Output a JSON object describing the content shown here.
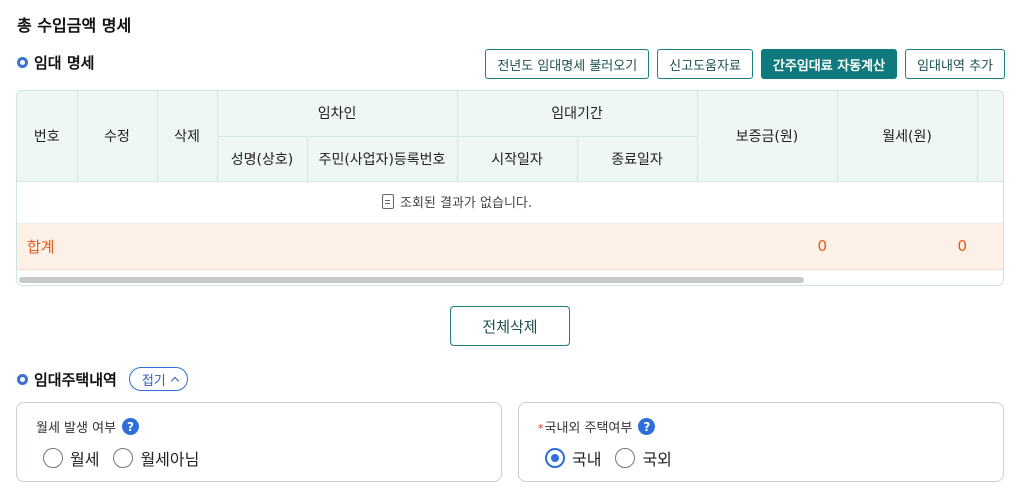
{
  "page_title": "총 수입금액 명세",
  "rental_section": {
    "title": "임대 명세",
    "buttons": {
      "load_prev": "전년도 임대명세 불러오기",
      "report_help": "신고도움자료",
      "auto_calc": "간주임대료 자동계산",
      "add": "임대내역 추가"
    }
  },
  "grid": {
    "headers": {
      "no": "번호",
      "edit": "수정",
      "delete": "삭제",
      "lessee": "임차인",
      "lessee_name": "성명(상호)",
      "lessee_id": "주민(사업자)등록번호",
      "period": "임대기간",
      "start": "시작일자",
      "end": "종료일자",
      "deposit": "보증금(원)",
      "monthly": "월세(원)"
    },
    "empty_message": "조회된 결과가 없습니다.",
    "sum_label": "합계",
    "sum_deposit": "0",
    "sum_monthly": "0"
  },
  "delete_all": "전체삭제",
  "housing_section": {
    "title": "임대주택내역",
    "fold_label": "접기"
  },
  "monthly_card": {
    "label": "월세 발생 여부",
    "help": "?",
    "options": [
      "월세",
      "월세아님"
    ],
    "selected": null
  },
  "domestic_card": {
    "required_mark": "*",
    "label": "국내외 주택여부",
    "help": "?",
    "options": [
      "국내",
      "국외"
    ],
    "selected": "국내"
  },
  "colors": {
    "accent": "#0f7a7e",
    "header_bg": "#eef7f6",
    "sum_bg": "#fdf0e6",
    "sum_text": "#e25a1c",
    "radio_blue": "#2f6ed8"
  }
}
